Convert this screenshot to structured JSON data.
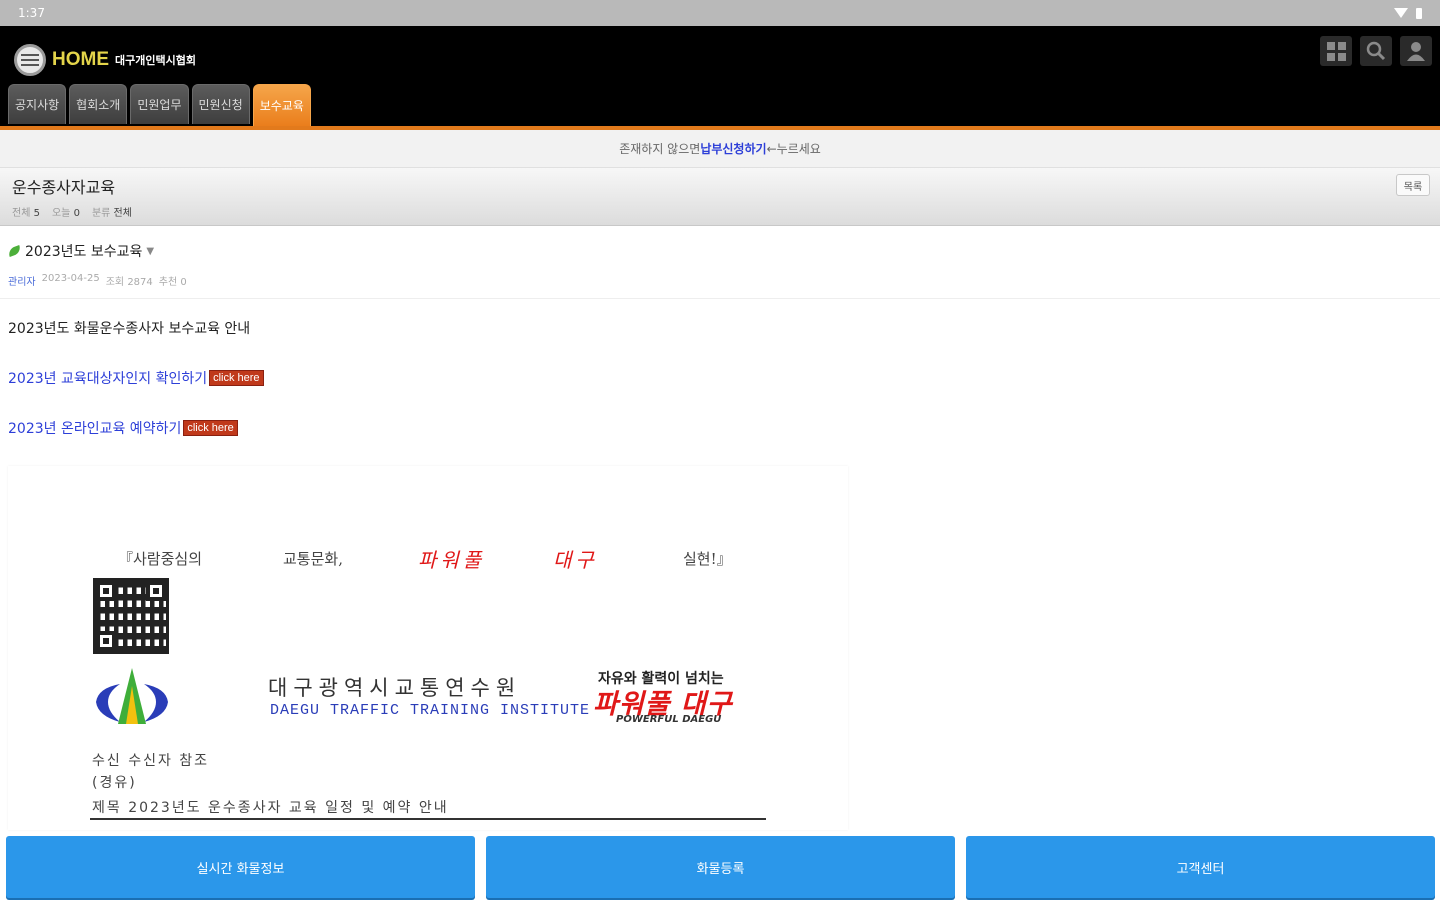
{
  "statusbar": {
    "time": "1:37"
  },
  "header": {
    "logo_text": "HOME",
    "logo_sub": "대구개인택시협회",
    "icons": [
      "grid-icon",
      "search-icon",
      "user-icon"
    ],
    "tabs": [
      {
        "label": "공지사항"
      },
      {
        "label": "협회소개"
      },
      {
        "label": "민원업무"
      },
      {
        "label": "민원신청"
      },
      {
        "label": "보수교육",
        "active": true
      }
    ]
  },
  "notice": {
    "prefix": "존재하지 않으면 ",
    "link": "납부신청하기",
    "suffix": "←누르세요"
  },
  "board": {
    "title": "운수종사자교육",
    "stats": {
      "total_label": "전체",
      "total": "5",
      "today_label": "오늘",
      "today": "0",
      "category_label": "분류",
      "category": "전체"
    },
    "list_button": "목록"
  },
  "post": {
    "title": "2023년도 보수교육",
    "author": "관리자",
    "date": "2023-04-25",
    "views": "조회 2874",
    "recommend": "추천 0",
    "lines": {
      "intro": "2023년도 화물운수종사자 보수교육 안내",
      "check_link": "2023년 교육대상자인지 확인하기",
      "reserve_link": "2023년 온라인교육 예약하기",
      "click_here": "click here"
    }
  },
  "document": {
    "slogan": {
      "s1": "『사람중심의",
      "s2": "교통문화,",
      "s3": "파워풀",
      "s4": "대구",
      "s5": "실현!』"
    },
    "institute_kr": "대구광역시교통연수원",
    "institute_en": "DAEGU TRAFFIC TRAINING INSTITUTE",
    "powerful_top": "자유와 활력이 넘치는",
    "powerful_main": "파워풀 대구",
    "powerful_en": "POWERFUL DAEGU",
    "recipient": "수신   수신자 참조",
    "via": "(경유)",
    "subject": "제목   2023년도 운수종사자 교육 일정 및 예약 안내"
  },
  "bottom": {
    "realtime": "실시간 화물정보",
    "register": "화물등록",
    "service": "고객센터"
  },
  "colors": {
    "accent": "#e27a1c",
    "button": "#2b97ea",
    "link": "#2d3fd8",
    "red": "#e01818"
  }
}
